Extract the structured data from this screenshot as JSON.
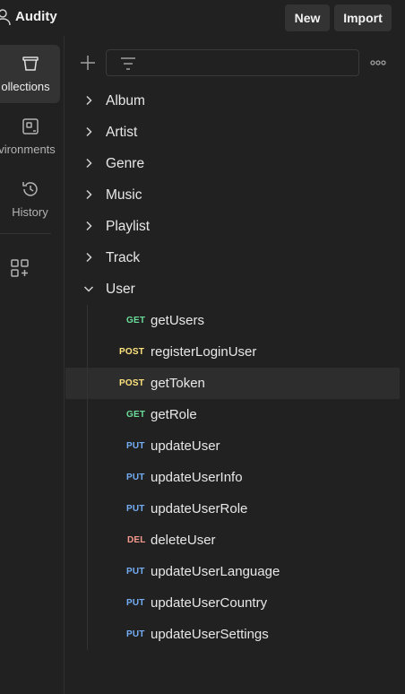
{
  "workspace": {
    "name": "Audity",
    "new_label": "New",
    "import_label": "Import"
  },
  "sidebar": {
    "items": [
      {
        "label": "Collections",
        "visible_text": "ollections",
        "icon": "collections-icon",
        "active": true
      },
      {
        "label": "Environments",
        "visible_text": "vironments",
        "icon": "environments-icon",
        "active": false
      },
      {
        "label": "History",
        "visible_text": "History",
        "icon": "history-icon",
        "active": false
      }
    ],
    "add_icon": "add-workspace-icon"
  },
  "toolbar": {
    "add_icon": "plus-icon",
    "filter_icon": "filter-icon",
    "more_icon": "more-icon"
  },
  "folders": [
    {
      "name": "Album",
      "expanded": false
    },
    {
      "name": "Artist",
      "expanded": false
    },
    {
      "name": "Genre",
      "expanded": false
    },
    {
      "name": "Music",
      "expanded": false
    },
    {
      "name": "Playlist",
      "expanded": false
    },
    {
      "name": "Track",
      "expanded": false
    },
    {
      "name": "User",
      "expanded": true
    }
  ],
  "requests": [
    {
      "method": "GET",
      "name": "getUsers",
      "selected": false
    },
    {
      "method": "POST",
      "name": "registerLoginUser",
      "selected": false
    },
    {
      "method": "POST",
      "name": "getToken",
      "selected": true
    },
    {
      "method": "GET",
      "name": "getRole",
      "selected": false
    },
    {
      "method": "PUT",
      "name": "updateUser",
      "selected": false
    },
    {
      "method": "PUT",
      "name": "updateUserInfo",
      "selected": false
    },
    {
      "method": "PUT",
      "name": "updateUserRole",
      "selected": false
    },
    {
      "method": "DEL",
      "name": "deleteUser",
      "selected": false
    },
    {
      "method": "PUT",
      "name": "updateUserLanguage",
      "selected": false
    },
    {
      "method": "PUT",
      "name": "updateUserCountry",
      "selected": false
    },
    {
      "method": "PUT",
      "name": "updateUserSettings",
      "selected": false
    }
  ],
  "colors": {
    "GET": "#6bdd9a",
    "POST": "#ffe47e",
    "PUT": "#74aef6",
    "DEL": "#f79a8e"
  }
}
